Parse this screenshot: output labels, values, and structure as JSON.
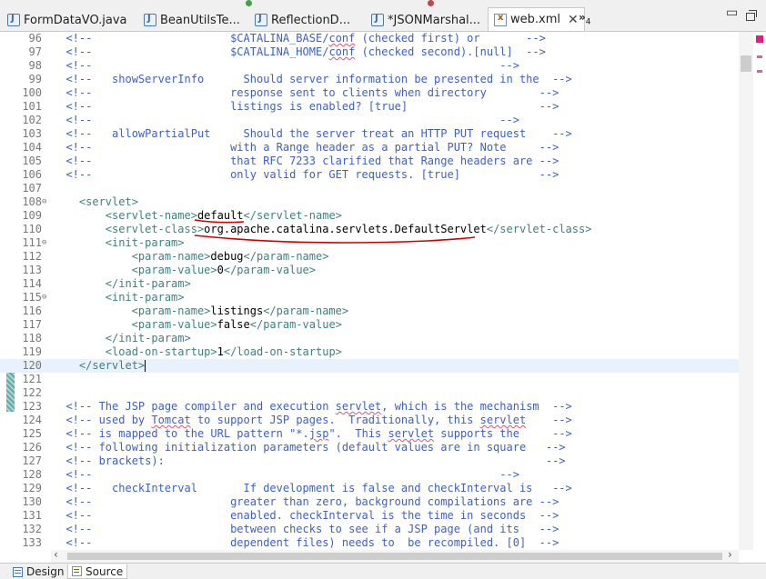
{
  "tabs": [
    {
      "label": "FormDataVO.java",
      "icon": "java-file-icon"
    },
    {
      "label": "BeanUtilsTe...",
      "icon": "java-file-icon"
    },
    {
      "label": "ReflectionD...",
      "icon": "java-file-icon"
    },
    {
      "label": "*JSONMarshal...",
      "icon": "java-file-icon"
    },
    {
      "label": "web.xml",
      "icon": "xml-file-icon",
      "active": true,
      "close": "✕"
    }
  ],
  "tab_overflow": {
    "label": "»",
    "count": "4"
  },
  "window_controls": {
    "minimize": "▭"
  },
  "editor": {
    "file": "web.xml",
    "lines": [
      {
        "n": "96",
        "segs": [
          [
            "c",
            "  <!--                     $CATALINA_BASE/"
          ],
          [
            "cq",
            "conf"
          ],
          [
            "c",
            " (checked first) or       -->"
          ]
        ]
      },
      {
        "n": "97",
        "segs": [
          [
            "c",
            "  <!--                     $CATALINA_HOME/"
          ],
          [
            "cq",
            "conf"
          ],
          [
            "c",
            " (checked second).[null]  -->"
          ]
        ]
      },
      {
        "n": "98",
        "segs": [
          [
            "c",
            "  <!--                                                              -->"
          ]
        ]
      },
      {
        "n": "99",
        "segs": [
          [
            "c",
            "  <!--   showServerInfo      Should server information be presented in the  -->"
          ]
        ]
      },
      {
        "n": "100",
        "segs": [
          [
            "c",
            "  <!--                     response sent to clients when directory        -->"
          ]
        ]
      },
      {
        "n": "101",
        "segs": [
          [
            "c",
            "  <!--                     listings is enabled? [true]                    -->"
          ]
        ]
      },
      {
        "n": "102",
        "segs": [
          [
            "c",
            "  <!--                                                              -->"
          ]
        ]
      },
      {
        "n": "103",
        "segs": [
          [
            "c",
            "  <!--   allowPartialPut     Should the server treat an HTTP PUT request    -->"
          ]
        ]
      },
      {
        "n": "104",
        "segs": [
          [
            "c",
            "  <!--                     with a Range header as a partial PUT? Note     -->"
          ]
        ]
      },
      {
        "n": "105",
        "segs": [
          [
            "c",
            "  <!--                     that RFC 7233 clarified that Range headers are -->"
          ]
        ]
      },
      {
        "n": "106",
        "segs": [
          [
            "c",
            "  <!--                     only valid for GET requests. [true]            -->"
          ]
        ]
      },
      {
        "n": "107",
        "segs": []
      },
      {
        "n": "108",
        "fold": true,
        "segs": [
          [
            "t",
            "    <servlet>"
          ]
        ]
      },
      {
        "n": "109",
        "segs": [
          [
            "t",
            "        <servlet-name>"
          ],
          [
            "x",
            "default"
          ],
          [
            "t",
            "</servlet-name>"
          ]
        ]
      },
      {
        "n": "110",
        "segs": [
          [
            "t",
            "        <servlet-class>"
          ],
          [
            "x",
            "org.apache.catalina.servlets.DefaultServlet"
          ],
          [
            "t",
            "</servlet-class>"
          ]
        ]
      },
      {
        "n": "111",
        "fold": true,
        "segs": [
          [
            "t",
            "        <init-param>"
          ]
        ]
      },
      {
        "n": "112",
        "segs": [
          [
            "t",
            "            <param-name>"
          ],
          [
            "x",
            "debug"
          ],
          [
            "t",
            "</param-name>"
          ]
        ]
      },
      {
        "n": "113",
        "segs": [
          [
            "t",
            "            <param-value>"
          ],
          [
            "x",
            "0"
          ],
          [
            "t",
            "</param-value>"
          ]
        ]
      },
      {
        "n": "114",
        "segs": [
          [
            "t",
            "        </init-param>"
          ]
        ]
      },
      {
        "n": "115",
        "fold": true,
        "segs": [
          [
            "t",
            "        <init-param>"
          ]
        ]
      },
      {
        "n": "116",
        "segs": [
          [
            "t",
            "            <param-name>"
          ],
          [
            "x",
            "listings"
          ],
          [
            "t",
            "</param-name>"
          ]
        ]
      },
      {
        "n": "117",
        "segs": [
          [
            "t",
            "            <param-value>"
          ],
          [
            "x",
            "false"
          ],
          [
            "t",
            "</param-value>"
          ]
        ]
      },
      {
        "n": "118",
        "segs": [
          [
            "t",
            "        </init-param>"
          ]
        ]
      },
      {
        "n": "119",
        "segs": [
          [
            "t",
            "        <load-on-startup>"
          ],
          [
            "x",
            "1"
          ],
          [
            "t",
            "</load-on-startup>"
          ]
        ]
      },
      {
        "n": "120",
        "current": true,
        "segs": [
          [
            "t",
            "    </servlet>"
          ],
          [
            "caret",
            ""
          ]
        ]
      },
      {
        "n": "121",
        "segs": []
      },
      {
        "n": "122",
        "segs": []
      },
      {
        "n": "123",
        "segs": [
          [
            "c",
            "  <!-- The JSP page compiler and execution "
          ],
          [
            "cq",
            "servlet"
          ],
          [
            "c",
            ", which is the mechanism  -->"
          ]
        ]
      },
      {
        "n": "124",
        "segs": [
          [
            "c",
            "  <!-- used by "
          ],
          [
            "cq",
            "Tomcat"
          ],
          [
            "c",
            " to support JSP pages.  Traditionally, this "
          ],
          [
            "cq",
            "servlet"
          ],
          [
            "c",
            "    -->"
          ]
        ]
      },
      {
        "n": "125",
        "segs": [
          [
            "c",
            "  <!-- is mapped to the URL pattern \"*."
          ],
          [
            "cq",
            "jsp"
          ],
          [
            "c",
            "\".  This "
          ],
          [
            "cq",
            "servlet"
          ],
          [
            "c",
            " supports the     -->"
          ]
        ]
      },
      {
        "n": "126",
        "segs": [
          [
            "c",
            "  <!-- following initialization parameters (default values are in square   -->"
          ]
        ]
      },
      {
        "n": "127",
        "segs": [
          [
            "c",
            "  <!-- brackets):                                                          -->"
          ]
        ]
      },
      {
        "n": "128",
        "segs": [
          [
            "c",
            "  <!--                                                              -->"
          ]
        ]
      },
      {
        "n": "129",
        "segs": [
          [
            "c",
            "  <!--   checkInterval       If development is false and checkInterval is   -->"
          ]
        ]
      },
      {
        "n": "130",
        "segs": [
          [
            "c",
            "  <!--                     greater than zero, background compilations are -->"
          ]
        ]
      },
      {
        "n": "131",
        "segs": [
          [
            "c",
            "  <!--                     enabled. checkInterval is the time in seconds  -->"
          ]
        ]
      },
      {
        "n": "132",
        "segs": [
          [
            "c",
            "  <!--                     between checks to see if a JSP page (and its   -->"
          ]
        ]
      },
      {
        "n": "133",
        "segs": [
          [
            "c",
            "  <!--                     dependent files) needs to  be recompiled. [0]  -->"
          ]
        ]
      }
    ]
  },
  "bottom_tabs": [
    {
      "label": "Design",
      "icon": "design-view-icon"
    },
    {
      "label": "Source",
      "icon": "source-view-icon",
      "active": true
    }
  ],
  "colors": {
    "comment": "#3f5fbf",
    "tag": "#3f7f7f",
    "text": "#000000",
    "current_line": "#e8f2fe",
    "annotation_underline": "#d00000"
  }
}
